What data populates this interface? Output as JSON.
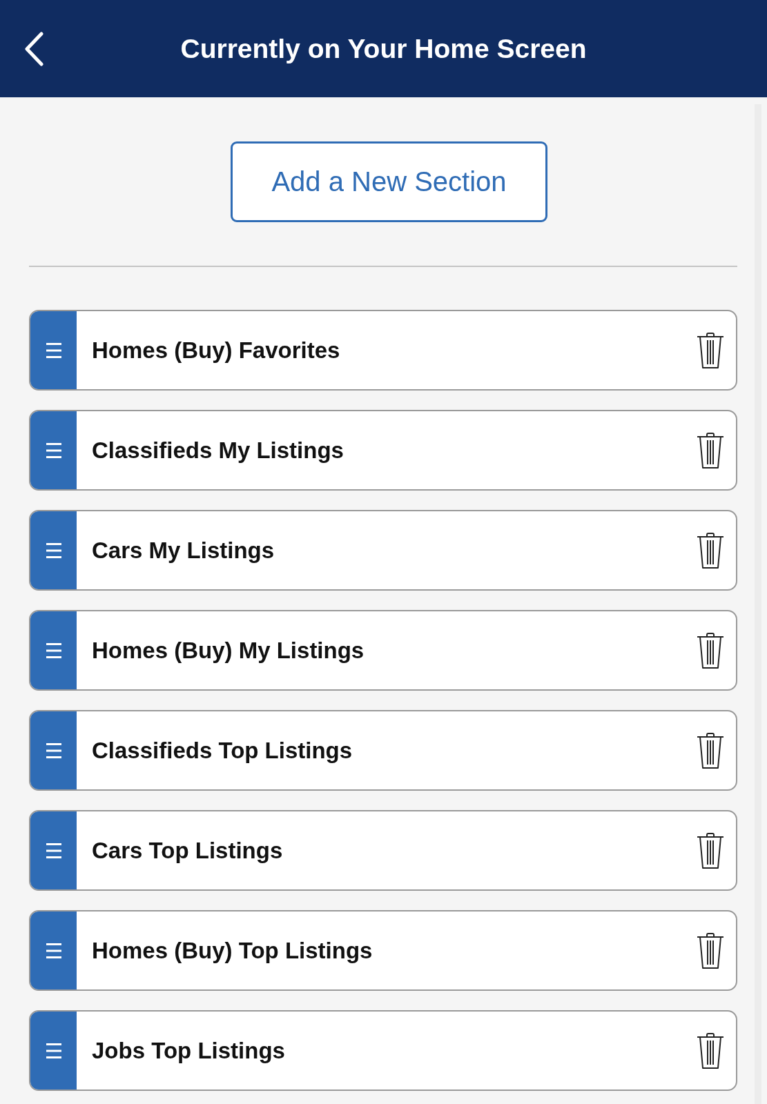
{
  "header": {
    "title": "Currently on Your Home Screen"
  },
  "add_button": {
    "label": "Add a New Section"
  },
  "sections": [
    {
      "label": "Homes (Buy) Favorites"
    },
    {
      "label": "Classifieds My Listings"
    },
    {
      "label": "Cars My Listings"
    },
    {
      "label": "Homes (Buy) My Listings"
    },
    {
      "label": "Classifieds Top Listings"
    },
    {
      "label": "Cars Top Listings"
    },
    {
      "label": "Homes (Buy) Top Listings"
    },
    {
      "label": "Jobs Top Listings"
    }
  ]
}
